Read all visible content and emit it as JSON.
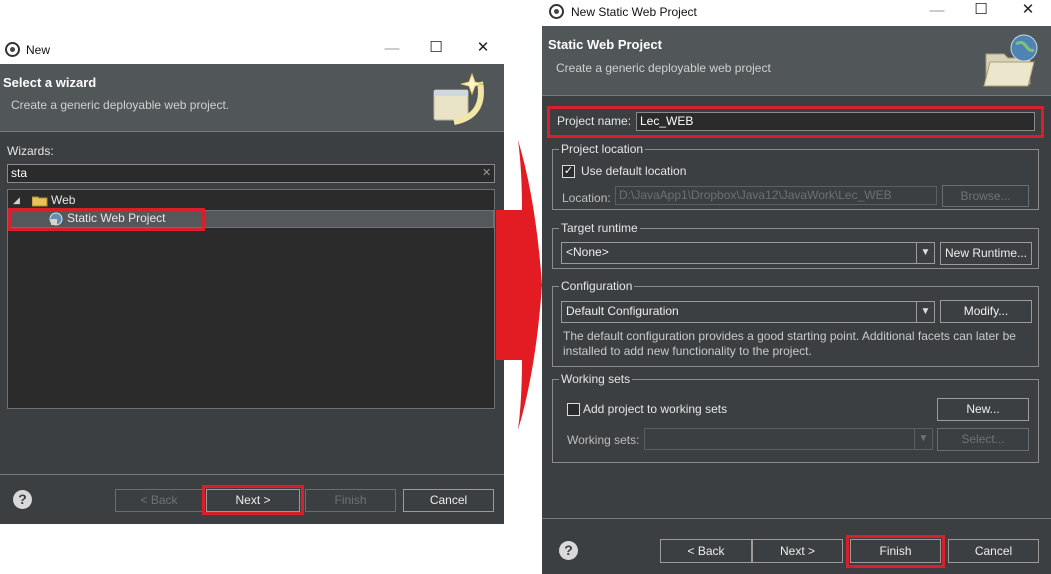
{
  "left_window": {
    "title": "New",
    "header": {
      "title": "Select a wizard",
      "description": "Create a generic deployable web project."
    },
    "wizards_label": "Wizards:",
    "filter_value": "sta",
    "clear_glyph": "✕",
    "tree": {
      "folder": "Web",
      "item": "Static Web Project"
    },
    "buttons": {
      "back": "< Back",
      "next": "Next >",
      "finish": "Finish",
      "cancel": "Cancel"
    },
    "help_glyph": "?"
  },
  "right_window": {
    "title": "New Static Web Project",
    "header": {
      "title": "Static Web Project",
      "description": "Create a generic deployable web project"
    },
    "project_name_label": "Project name:",
    "project_name_value": "Lec_WEB",
    "project_location": {
      "group_title": "Project location",
      "use_default_label": "Use default location",
      "use_default_checked": true,
      "location_label": "Location:",
      "location_value": "D:\\JavaApp1\\Dropbox\\Java12\\JavaWork\\Lec_WEB",
      "browse_label": "Browse..."
    },
    "target_runtime": {
      "group_title": "Target runtime",
      "selected": "<None>",
      "new_runtime_label": "New Runtime..."
    },
    "configuration": {
      "group_title": "Configuration",
      "selected": "Default Configuration",
      "modify_label": "Modify...",
      "description": "The default configuration provides a good starting point. Additional facets can later be installed to add new functionality to the project."
    },
    "working_sets": {
      "group_title": "Working sets",
      "add_label": "Add project to working sets",
      "add_checked": false,
      "new_label": "New...",
      "working_sets_label": "Working sets:",
      "working_sets_value": "",
      "select_label": "Select..."
    },
    "buttons": {
      "back": "< Back",
      "next": "Next >",
      "finish": "Finish",
      "cancel": "Cancel"
    },
    "help_glyph": "?"
  },
  "window_controls": {
    "minimize": "—",
    "maximize": "☐",
    "close": "✕"
  },
  "colors": {
    "highlight": "#d91f2a",
    "dialog_bg": "#3c3f41",
    "header_bg": "#515658"
  }
}
